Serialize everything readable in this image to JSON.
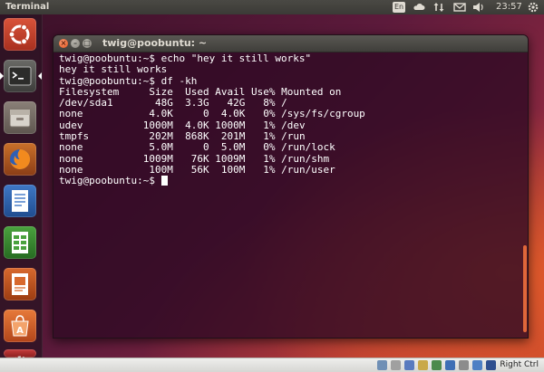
{
  "panel": {
    "app_title": "Terminal",
    "lang": "En",
    "clock": "23:57",
    "icons": [
      "cloud-icon",
      "network-updown-icon",
      "mail-icon",
      "volume-icon",
      "power-gear-icon"
    ]
  },
  "launcher": {
    "items": [
      {
        "name": "ubuntu-dash-icon"
      },
      {
        "name": "terminal-app-icon"
      },
      {
        "name": "files-app-icon"
      },
      {
        "name": "firefox-app-icon"
      },
      {
        "name": "libreoffice-writer-icon"
      },
      {
        "name": "libreoffice-calc-icon"
      },
      {
        "name": "libreoffice-impress-icon"
      },
      {
        "name": "software-center-icon"
      },
      {
        "name": "system-settings-icon"
      }
    ]
  },
  "window": {
    "title": "twig@poobuntu: ~"
  },
  "terminal": {
    "prompt": "twig@poobuntu:~$ ",
    "cmd1": "echo \"hey it still works\"",
    "out1": "hey it still works",
    "cmd2": "df -kh",
    "df_header": [
      "Filesystem",
      "Size",
      "Used",
      "Avail",
      "Use%",
      "Mounted on"
    ],
    "df_rows": [
      [
        "/dev/sda1",
        "48G",
        "3.3G",
        "42G",
        "8%",
        "/"
      ],
      [
        "none",
        "4.0K",
        "0",
        "4.0K",
        "0%",
        "/sys/fs/cgroup"
      ],
      [
        "udev",
        "1000M",
        "4.0K",
        "1000M",
        "1%",
        "/dev"
      ],
      [
        "tmpfs",
        "202M",
        "868K",
        "201M",
        "1%",
        "/run"
      ],
      [
        "none",
        "5.0M",
        "0",
        "5.0M",
        "0%",
        "/run/lock"
      ],
      [
        "none",
        "1009M",
        "76K",
        "1009M",
        "1%",
        "/run/shm"
      ],
      [
        "none",
        "100M",
        "56K",
        "100M",
        "1%",
        "/run/user"
      ]
    ],
    "final_prompt": "twig@poobuntu:~$ "
  },
  "vm_bar": {
    "host_key": "Right Ctrl"
  },
  "colors": {
    "ubuntu_orange": "#e95420",
    "terminal_bg": "#300a24"
  }
}
